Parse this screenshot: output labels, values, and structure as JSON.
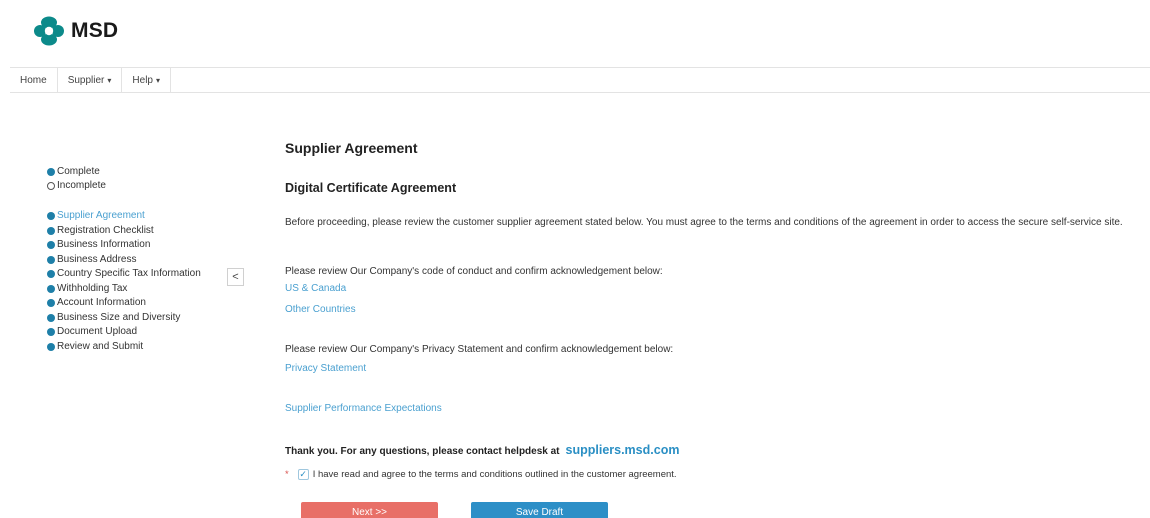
{
  "header": {
    "logo_text": "MSD",
    "logo_icon": "msd-logo-icon"
  },
  "nav": {
    "items": [
      {
        "label": "Home",
        "has_caret": false
      },
      {
        "label": "Supplier",
        "has_caret": true
      },
      {
        "label": "Help",
        "has_caret": true
      }
    ],
    "caret": "▾"
  },
  "legend": {
    "complete": "Complete",
    "incomplete": "Incomplete"
  },
  "steps": [
    {
      "label": "Supplier Agreement",
      "active": true
    },
    {
      "label": "Registration Checklist",
      "active": false
    },
    {
      "label": "Business Information",
      "active": false
    },
    {
      "label": "Business Address",
      "active": false
    },
    {
      "label": "Country Specific Tax Information",
      "active": false
    },
    {
      "label": "Withholding Tax",
      "active": false
    },
    {
      "label": "Account Information",
      "active": false
    },
    {
      "label": "Business Size and Diversity",
      "active": false
    },
    {
      "label": "Document Upload",
      "active": false
    },
    {
      "label": "Review and Submit",
      "active": false
    }
  ],
  "collapse_glyph": "<",
  "main": {
    "title": "Supplier Agreement",
    "subtitle": "Digital Certificate Agreement",
    "intro": "Before proceeding, please review the customer supplier agreement stated below. You must agree to the terms and conditions of the agreement in order to access the secure self-service site.",
    "conduct_text": "Please review Our Company's code of conduct and confirm acknowledgement below:",
    "conduct_links": [
      "US & Canada",
      "Other Countries"
    ],
    "privacy_text": "Please review Our Company's Privacy Statement and confirm acknowledgement below:",
    "privacy_link": "Privacy Statement",
    "performance_link": "Supplier Performance Expectations",
    "thanks_text": "Thank you. For any questions, please contact helpdesk at",
    "helpdesk_site": "suppliers.msd.com",
    "required_mark": "*",
    "agree_text": "I have read and agree to the terms and conditions outlined in the customer agreement.",
    "agree_checked": true,
    "check_glyph": "✓",
    "next_label": "Next >>",
    "save_label": "Save Draft"
  },
  "colors": {
    "accent": "#2d8fc7",
    "link": "#4aa0d0",
    "next": "#e86f67",
    "brand": "#0c8a8a"
  }
}
